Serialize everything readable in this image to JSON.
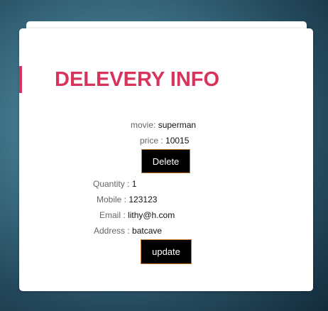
{
  "page": {
    "title": "DELEVERY INFO"
  },
  "movie": {
    "label": "movie:",
    "value": "superman"
  },
  "price": {
    "label": "price :",
    "value": "10015"
  },
  "delete_button": {
    "label": "Delete"
  },
  "form": {
    "quantity": {
      "label": "Quantity :",
      "value": "1"
    },
    "mobile": {
      "label": "Mobile :",
      "value": "123123"
    },
    "email": {
      "label": "Email :",
      "value": "lithy@h.com"
    },
    "address": {
      "label": "Address :",
      "value": "batcave"
    }
  },
  "update_button": {
    "label": "update"
  },
  "colors": {
    "accent": "#d8335b",
    "button_bg": "#000000",
    "button_border": "#c8782a"
  }
}
